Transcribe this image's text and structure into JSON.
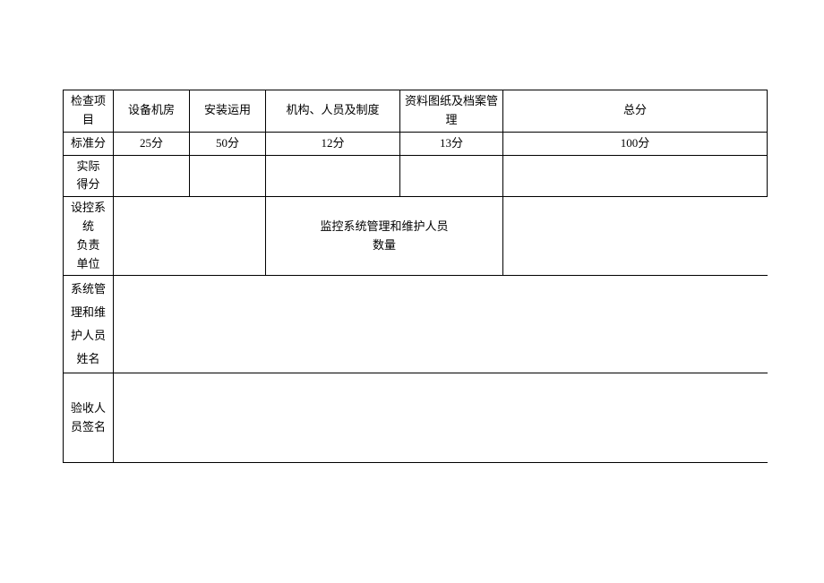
{
  "row1": {
    "c1": "检查项目",
    "c2": "设备机房",
    "c3": "安装运用",
    "c4": "机构、人员及制度",
    "c5": "资料图纸及档案管\n理",
    "c6": "总分"
  },
  "row2": {
    "c1": "标准分",
    "c2": "25分",
    "c3": "50分",
    "c4": "12分",
    "c5": "13分",
    "c6": "100分"
  },
  "row3": {
    "c1": "实际\n得分",
    "c2": "",
    "c3": "",
    "c4": "",
    "c5": "",
    "c6": ""
  },
  "row4": {
    "c1": "设控系统\n负责\n单位",
    "c2": "",
    "c3": "监控系统管理和维护人员\n数量",
    "c4": ""
  },
  "row5": {
    "c1": "系统管\n理和维\n护人员\n姓名",
    "c2": ""
  },
  "row6": {
    "c1": "验收人\n员签名",
    "c2": ""
  }
}
